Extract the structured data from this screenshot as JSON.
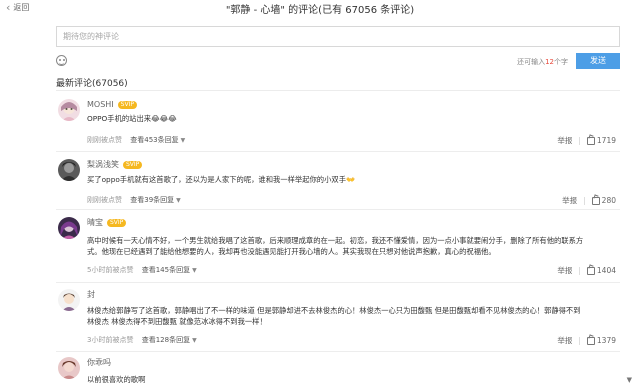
{
  "header": {
    "back_label": "返回",
    "title": "\"郭静 - 心墙\" 的评论(已有 67056 条评论)"
  },
  "composer": {
    "placeholder": "期待您的神评论",
    "counter_prefix": "还可输入",
    "counter_num": "12",
    "counter_suffix": "个字",
    "send_label": "发送"
  },
  "comments_header": "最新评论(67056)",
  "comments": [
    {
      "user": "MOSHI",
      "badge": "SVIP",
      "lines": [
        "OPPO手机的站出来😂😂😂"
      ],
      "time": "刚刚被点赞",
      "replies": "查看453条回复",
      "report": "举报",
      "likes": "1719"
    },
    {
      "user": "梨涡浅笑",
      "badge": "SVIP",
      "lines": [
        "买了oppo手机就有这首歌了，还以为是人家下的呢，谁和我一样举起你的小双手👐"
      ],
      "time": "刚刚被点赞",
      "replies": "查看39条回复",
      "report": "举报",
      "likes": "280"
    },
    {
      "user": "晴宝",
      "badge": "SVIP",
      "lines": [
        "高中时候有一天心情不好，一个男生就给我唱了这首歌，后来顺理成章的在一起。初恋，我还不懂爱情，因为一点小事就要闹分手，删除了所有他的联系方",
        "式。他现在已经遇到了能给他想要的人，我却再也没能遇见能打开我心墙的人。其实我现在只想对他说声抱歉，真心的祝福他。"
      ],
      "time": "5小时前被点赞",
      "replies": "查看145条回复",
      "report": "举报",
      "likes": "1404"
    },
    {
      "user": "封",
      "badge": "",
      "lines": [
        "林俊杰给郭静写了这首歌，郭静唱出了不一样的味道 但是郭静却进不去林俊杰的心！林俊杰一心只为田馥甄 但是田馥甄却看不见林俊杰的心！郭静得不到",
        "林俊杰 林俊杰得不到田馥甄 就像范冰冰得不到我一样！"
      ],
      "time": "3小时前被点赞",
      "replies": "查看128条回复",
      "report": "举报",
      "likes": "1379"
    },
    {
      "user": "你乖吗",
      "badge": "",
      "lines": [
        "以前很喜欢的歌啊"
      ],
      "time": "",
      "replies": "",
      "report": "",
      "likes": ""
    }
  ],
  "colors": {
    "send_button": "#4d9ee6",
    "counter_highlight": "#e84a3c",
    "svip_badge": "#f5b821"
  }
}
